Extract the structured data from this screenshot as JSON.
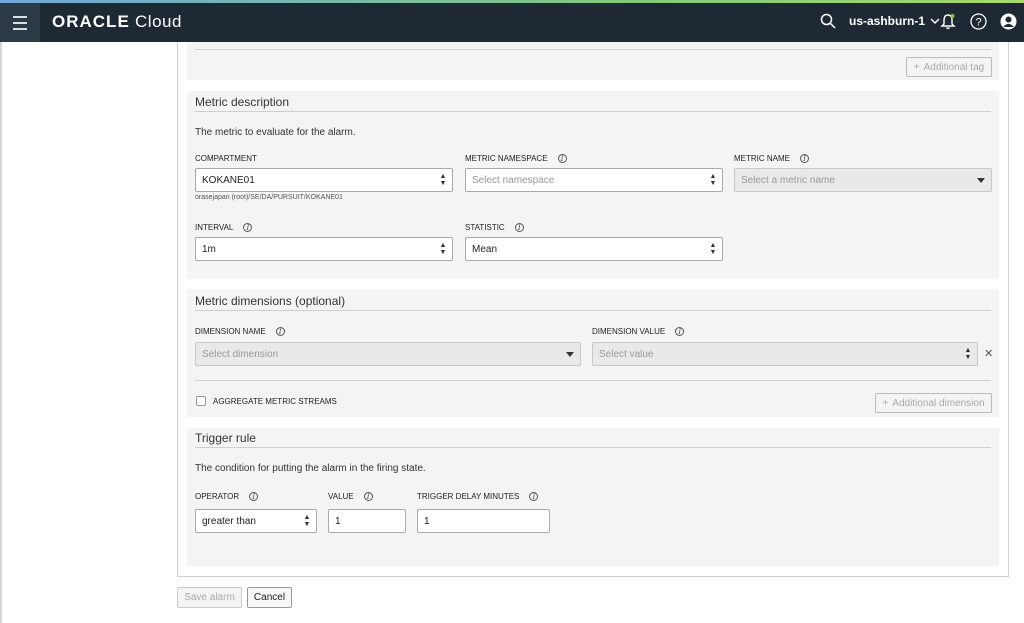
{
  "header": {
    "brand_bold": "ORACLE",
    "brand_light": "Cloud",
    "region": "us-ashburn-1",
    "icons": [
      "menu-icon",
      "search-icon",
      "chevron-down-icon",
      "bell-icon",
      "help-icon",
      "user-icon"
    ]
  },
  "tags": {
    "additional_tag_label": "Additional tag"
  },
  "metric_description": {
    "title": "Metric description",
    "description": "The metric to evaluate for the alarm.",
    "compartment": {
      "label": "COMPARTMENT",
      "value": "KOKANE01",
      "path": "orasejapan (root)/SE/DA/PURSUIT/KOKANE01"
    },
    "metric_namespace": {
      "label": "METRIC NAMESPACE",
      "placeholder": "Select namespace"
    },
    "metric_name": {
      "label": "METRIC NAME",
      "placeholder": "Select a metric name"
    },
    "interval": {
      "label": "INTERVAL",
      "value": "1m"
    },
    "statistic": {
      "label": "STATISTIC",
      "value": "Mean"
    }
  },
  "metric_dimensions": {
    "title": "Metric dimensions (optional)",
    "dimension_name": {
      "label": "DIMENSION NAME",
      "placeholder": "Select dimension"
    },
    "dimension_value": {
      "label": "DIMENSION VALUE",
      "placeholder": "Select value"
    },
    "aggregate_label": "AGGREGATE METRIC STREAMS",
    "additional_dimension_label": "Additional dimension"
  },
  "trigger_rule": {
    "title": "Trigger rule",
    "description": "The condition for putting the alarm in the firing state.",
    "operator": {
      "label": "OPERATOR",
      "value": "greater than"
    },
    "value_field": {
      "label": "VALUE",
      "value": "1"
    },
    "delay": {
      "label": "TRIGGER DELAY MINUTES",
      "value": "1"
    }
  },
  "footer": {
    "save_label": "Save alarm",
    "cancel_label": "Cancel"
  },
  "colors": {
    "topbar": "#1f2933",
    "section_bg": "#f4f4f4"
  }
}
